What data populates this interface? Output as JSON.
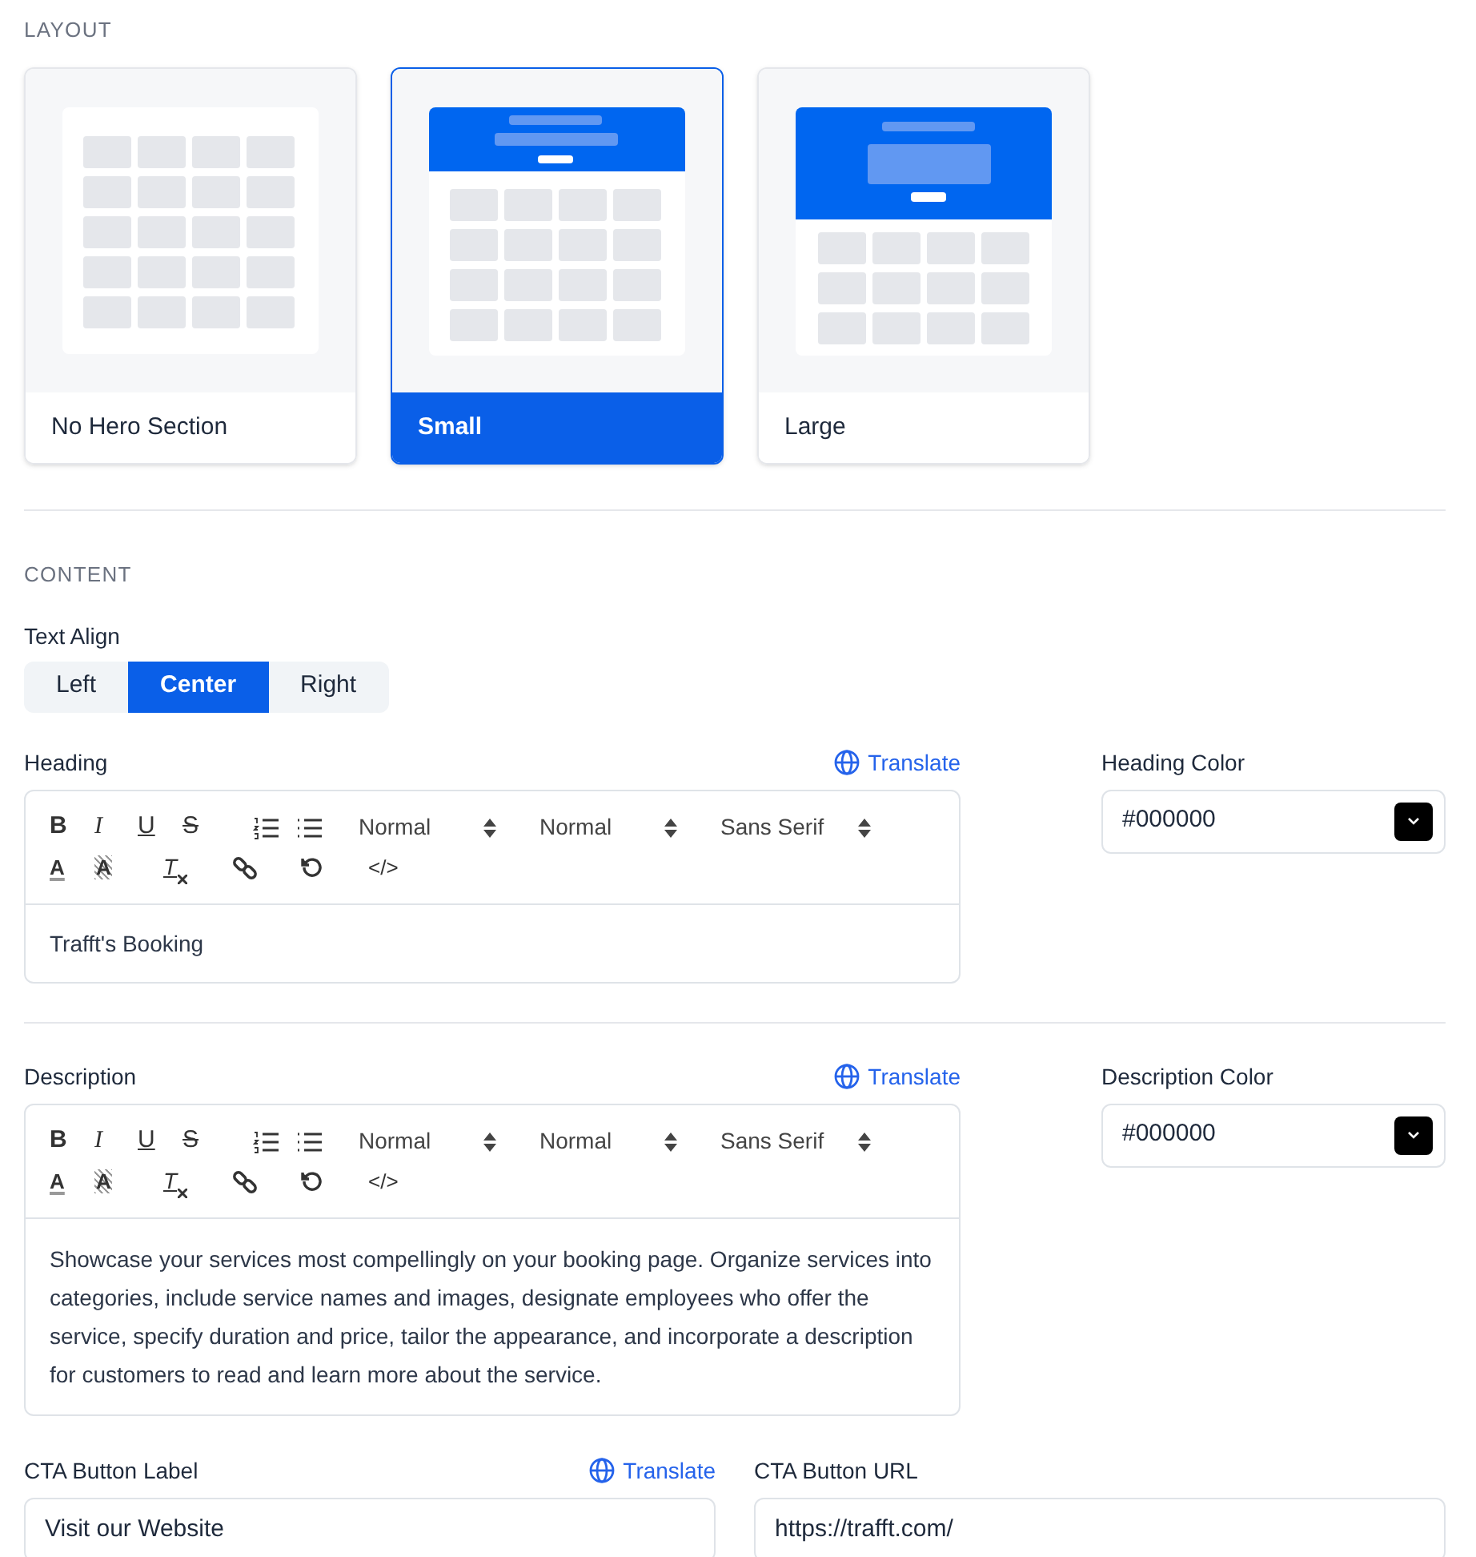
{
  "layout": {
    "title": "LAYOUT",
    "options": [
      {
        "label": "No Hero Section",
        "kind": "none",
        "selected": false
      },
      {
        "label": "Small",
        "kind": "small",
        "selected": true
      },
      {
        "label": "Large",
        "kind": "large",
        "selected": false
      }
    ]
  },
  "content": {
    "title": "CONTENT",
    "text_align": {
      "label": "Text Align",
      "options": [
        {
          "label": "Left",
          "selected": false
        },
        {
          "label": "Center",
          "selected": true
        },
        {
          "label": "Right",
          "selected": false
        }
      ]
    },
    "heading": {
      "label": "Heading",
      "translate": "Translate",
      "toolbar": [
        {
          "kind": "bold",
          "label": "B"
        },
        {
          "kind": "italic",
          "label": "I"
        },
        {
          "kind": "underline",
          "label": "U"
        },
        {
          "kind": "strike",
          "label": "S"
        },
        {
          "kind": "ordered-list"
        },
        {
          "kind": "bullet-list"
        },
        {
          "kind": "select",
          "label": "Normal"
        },
        {
          "kind": "select",
          "label": "Normal"
        },
        {
          "kind": "select",
          "label": "Sans Serif"
        },
        {
          "kind": "break"
        },
        {
          "kind": "color",
          "label": "A"
        },
        {
          "kind": "background",
          "label": "A"
        },
        {
          "kind": "clean",
          "label": "T"
        },
        {
          "kind": "link"
        },
        {
          "kind": "undo"
        },
        {
          "kind": "code",
          "label": "</>"
        }
      ],
      "value": "Trafft's Booking"
    },
    "heading_color": {
      "label": "Heading Color",
      "value": "#000000"
    },
    "description": {
      "label": "Description",
      "translate": "Translate",
      "toolbar": [
        {
          "kind": "bold",
          "label": "B"
        },
        {
          "kind": "italic",
          "label": "I"
        },
        {
          "kind": "underline",
          "label": "U"
        },
        {
          "kind": "strike",
          "label": "S"
        },
        {
          "kind": "ordered-list"
        },
        {
          "kind": "bullet-list"
        },
        {
          "kind": "select",
          "label": "Normal"
        },
        {
          "kind": "select",
          "label": "Normal"
        },
        {
          "kind": "select",
          "label": "Sans Serif"
        },
        {
          "kind": "break"
        },
        {
          "kind": "color",
          "label": "A"
        },
        {
          "kind": "background",
          "label": "A"
        },
        {
          "kind": "clean",
          "label": "T"
        },
        {
          "kind": "link"
        },
        {
          "kind": "undo"
        },
        {
          "kind": "code",
          "label": "</>"
        }
      ],
      "value": "Showcase your services most compellingly on your booking page. Organize services into categories, include service names and images, designate employees who offer the service, specify duration and price, tailor the appearance, and incorporate a description for customers to read and learn more about the service."
    },
    "description_color": {
      "label": "Description Color",
      "value": "#000000"
    },
    "cta_label": {
      "label": "CTA Button Label",
      "translate": "Translate",
      "value": "Visit our Website"
    },
    "cta_url": {
      "label": "CTA Button URL",
      "value": "https://trafft.com/"
    }
  }
}
